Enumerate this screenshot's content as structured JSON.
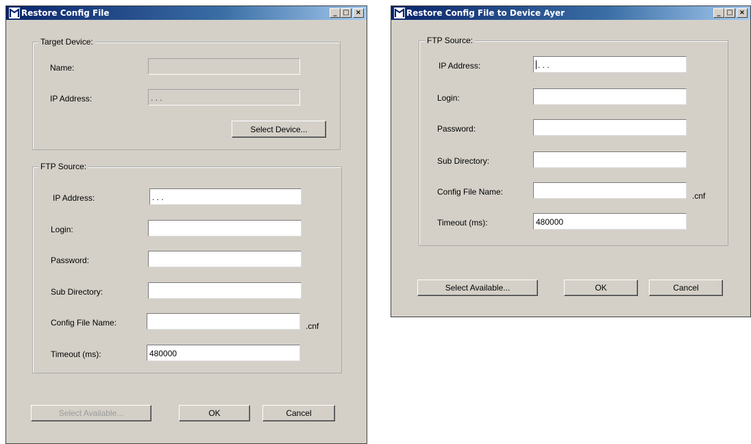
{
  "left_window": {
    "title": "Restore Config File",
    "controls": {
      "minimize": "_",
      "maximize": "□",
      "close": "×"
    },
    "target_device": {
      "group_label": "Target Device:",
      "name_label": "Name:",
      "name_value": "",
      "ip_label": "IP Address:",
      "ip_value": ".   .   .",
      "select_device_button": "Select Device..."
    },
    "ftp_source": {
      "group_label": "FTP Source:",
      "ip_label": "IP Address:",
      "ip_value": ".   .   .",
      "login_label": "Login:",
      "login_value": "",
      "password_label": "Password:",
      "password_value": "",
      "subdir_label": "Sub Directory:",
      "subdir_value": "",
      "config_label": "Config File Name:",
      "config_value": "",
      "config_suffix": ".cnf",
      "timeout_label": "Timeout (ms):",
      "timeout_value": "480000"
    },
    "buttons": {
      "select_available": "Select Available...",
      "ok": "OK",
      "cancel": "Cancel"
    }
  },
  "right_window": {
    "title": "Restore Config File to Device Ayer",
    "controls": {
      "minimize": "_",
      "maximize": "□",
      "close": "×"
    },
    "ftp_source": {
      "group_label": "FTP Source:",
      "ip_label": "IP Address:",
      "ip_value": ".   .   .",
      "login_label": "Login:",
      "login_value": "",
      "password_label": "Password:",
      "password_value": "",
      "subdir_label": "Sub Directory:",
      "subdir_value": "",
      "config_label": "Config File Name:",
      "config_value": "",
      "config_suffix": ".cnf",
      "timeout_label": "Timeout (ms):",
      "timeout_value": "480000"
    },
    "buttons": {
      "select_available": "Select Available...",
      "ok": "OK",
      "cancel": "Cancel"
    }
  }
}
